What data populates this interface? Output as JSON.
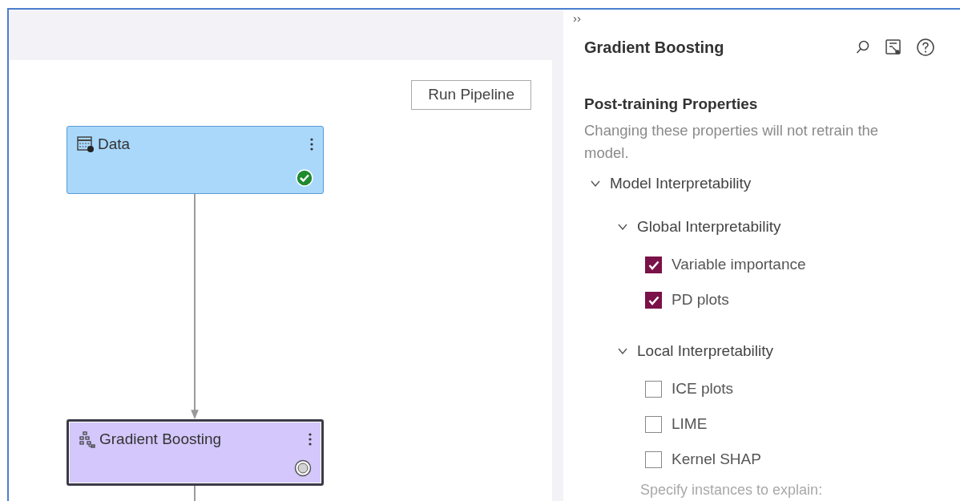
{
  "canvas": {
    "run_button": "Run Pipeline",
    "nodes": [
      {
        "label": "Data",
        "kind": "data",
        "complete": true,
        "selected": false
      },
      {
        "label": "Gradient Boosting",
        "kind": "model",
        "complete": false,
        "selected": true
      }
    ]
  },
  "panel": {
    "collapse_toggle": "››",
    "title": "Gradient Boosting",
    "section_title": "Post-training Properties",
    "description": "Changing these properties will not retrain the model.",
    "tree": [
      {
        "label": "Model Interpretability",
        "expanded": true,
        "children": [
          {
            "label": "Global Interpretability",
            "expanded": true,
            "children": [
              {
                "label": "Variable importance",
                "checked": true
              },
              {
                "label": "PD plots",
                "checked": true
              }
            ]
          },
          {
            "label": "Local Interpretability",
            "expanded": true,
            "children": [
              {
                "label": "ICE plots",
                "checked": false
              },
              {
                "label": "LIME",
                "checked": false
              },
              {
                "label": "Kernel SHAP",
                "checked": false
              }
            ]
          }
        ]
      }
    ],
    "footer_text": "Specify instances to explain:"
  }
}
